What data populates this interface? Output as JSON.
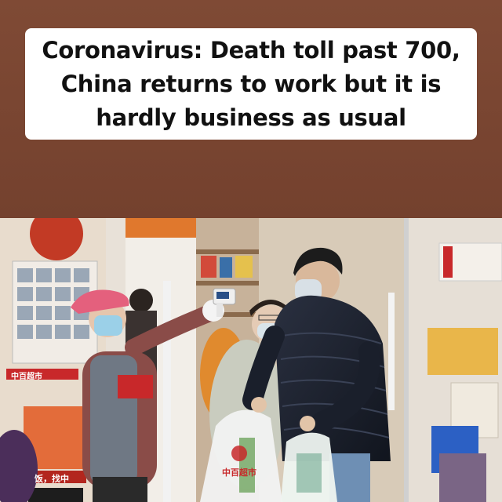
{
  "headline": {
    "line1": "Coronavirus: Death toll past 700,",
    "line2": "China returns to work but it is",
    "line3": "hardly business as usual"
  },
  "photo": {
    "shop_sign_left": "中百超市",
    "shop_sign_menu": "饭，找中",
    "bag_print": "中百超市",
    "thermometer_display": "36"
  },
  "colors": {
    "background_band": "#7a4733",
    "headline_box": "#ffffff",
    "headline_text": "#111111"
  }
}
